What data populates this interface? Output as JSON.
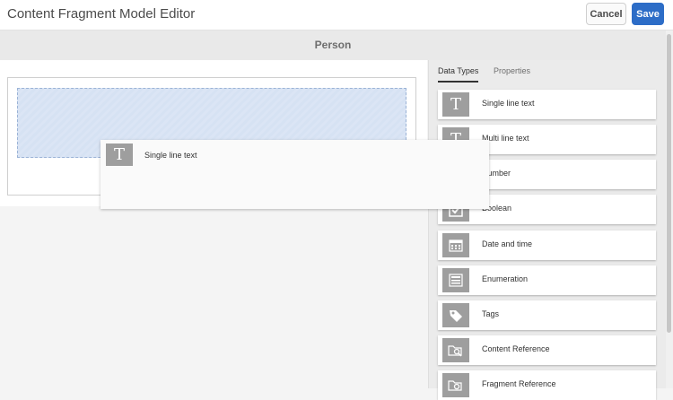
{
  "header": {
    "title": "Content Fragment Model Editor",
    "cancel_label": "Cancel",
    "save_label": "Save"
  },
  "model": {
    "name": "Person"
  },
  "panel": {
    "tabs": [
      {
        "label": "Data Types",
        "active": true
      },
      {
        "label": "Properties",
        "active": false
      }
    ],
    "items": [
      {
        "label": "Single line text",
        "icon": "text-t-icon"
      },
      {
        "label": "Multi line text",
        "icon": "text-t-icon"
      },
      {
        "label": "Number",
        "icon": "number-icon"
      },
      {
        "label": "Boolean",
        "icon": "checkbox-icon"
      },
      {
        "label": "Date and time",
        "icon": "calendar-icon"
      },
      {
        "label": "Enumeration",
        "icon": "list-icon"
      },
      {
        "label": "Tags",
        "icon": "tag-icon"
      },
      {
        "label": "Content Reference",
        "icon": "folder-search-icon"
      },
      {
        "label": "Fragment Reference",
        "icon": "folder-link-icon"
      }
    ]
  },
  "drag": {
    "label": "Single line text",
    "icon": "text-t-icon"
  },
  "colors": {
    "primary": "#2d6dc7",
    "drop_zone": "#d6e2f3",
    "icon_bg": "#9e9e9e"
  }
}
